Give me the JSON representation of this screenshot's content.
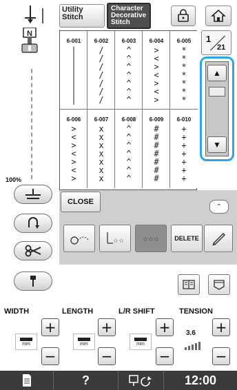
{
  "header": {
    "tab_utility": "Utility\nStitch",
    "tab_utility_line1": "Utility",
    "tab_utility_line2": "Stitch",
    "tab_char_line1": "Character",
    "tab_char_line2": "Decorative",
    "tab_char_line3": "Stitch",
    "foot_letter": "N"
  },
  "zoom": "100%",
  "stitches": [
    {
      "code": "6-001",
      "glyph": "|\n|\n|\n|\n|\n|\n|"
    },
    {
      "code": "6-002",
      "glyph": "/\n/\n/\n/\n/\n/\n/"
    },
    {
      "code": "6-003",
      "glyph": "^\n^\n^\n^\n^\n^\n^"
    },
    {
      "code": "6-004",
      "glyph": ">\n<\n>\n<\n>\n<\n>"
    },
    {
      "code": "6-005",
      "glyph": "*\n*\n*\n*\n*\n*\n*"
    },
    {
      "code": "6-006",
      "glyph": ">\n<\n>\n<\n>\n<\n>"
    },
    {
      "code": "6-007",
      "glyph": "x\nx\nx\nx\nx\nx\nx"
    },
    {
      "code": "6-008",
      "glyph": "^\n^\n^\n^\n^\n^\n^"
    },
    {
      "code": "6-009",
      "glyph": "#\n#\n#\n#\n#\n#\n#"
    },
    {
      "code": "6-010",
      "glyph": "+\n+\n+\n+\n+\n+\n+"
    }
  ],
  "pagination": {
    "current": "1",
    "total": "21"
  },
  "edit": {
    "close_label": "CLOSE",
    "delete_label": "DELETE"
  },
  "adjust": {
    "width_label": "WIDTH",
    "length_label": "LENGTH",
    "lr_label": "L/R SHIFT",
    "tension_label": "TENSION",
    "unit": "mm",
    "tension_value": "3.6",
    "plus": "+",
    "minus": "−"
  },
  "bottom": {
    "help": "?",
    "time": "12:00"
  },
  "colors": {
    "accent_scroll_border": "#2aa7e5",
    "bottom_bar": "#3a3a3a"
  }
}
